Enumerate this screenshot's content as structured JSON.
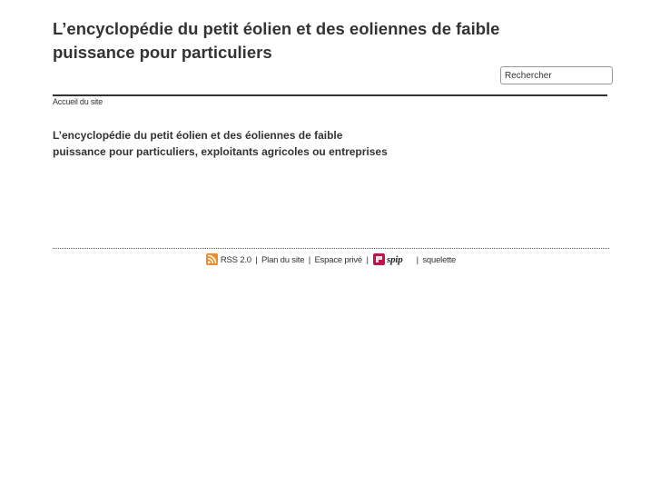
{
  "header": {
    "site_title_line1": "L’encyclopédie du petit éolien et des eoliennes de faible",
    "site_title_line2": "puissance pour particuliers",
    "search": {
      "value": "Rechercher"
    }
  },
  "breadcrumb": {
    "home_label": "Accueil du site"
  },
  "main": {
    "intro_line1": "L’encyclopédie du petit éolien et des éoliennes de faible",
    "intro_line2": "puissance pour particuliers, exploitants agricoles ou entreprises"
  },
  "footer": {
    "rss_icon": "rss-feed-icon",
    "rss_label": "RSS 2.0",
    "separator": "|",
    "sitemap_label": "Plan du site",
    "private_label": "Espace privé",
    "spip_logo": "spip-logo",
    "skeleton_label": "squelette"
  },
  "colors": {
    "text": "#333333",
    "rss_orange": "#f08a24",
    "spip_red": "#c5114b"
  }
}
